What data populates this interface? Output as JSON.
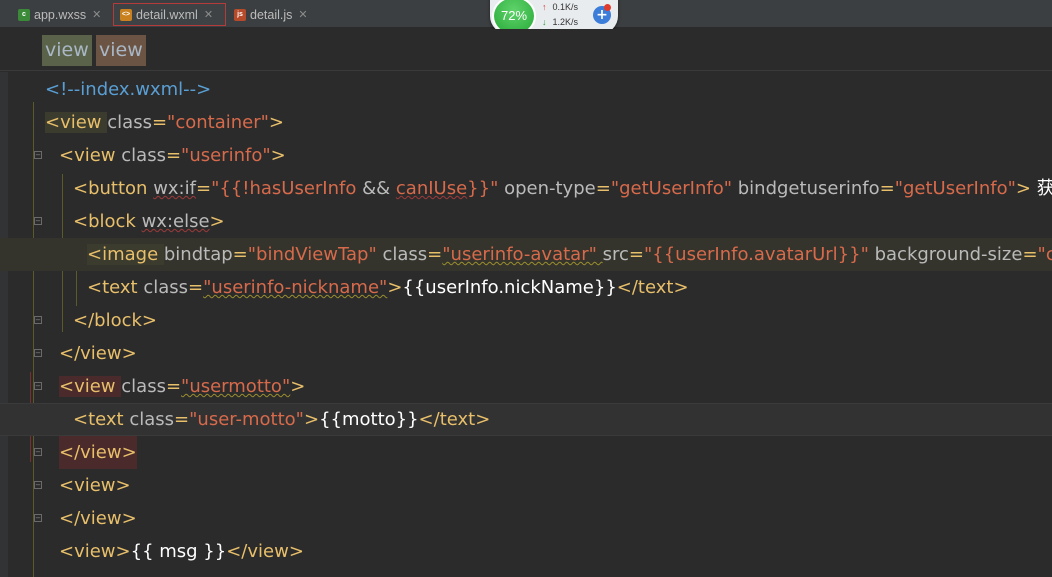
{
  "tabs": [
    {
      "label": "app.wxss",
      "icon": "css-file-icon",
      "active": false
    },
    {
      "label": "detail.wxml",
      "icon": "xml-file-icon",
      "active": true
    },
    {
      "label": "detail.js",
      "icon": "js-file-icon",
      "active": false
    }
  ],
  "net_widget": {
    "percent": "72%",
    "upload": "0.1K/s",
    "download": "1.2K/s"
  },
  "breadcrumb": [
    "view",
    "view"
  ],
  "code": {
    "l1": "<!--index.wxml-->",
    "l2_tag": "<view ",
    "l2_attr": "class",
    "l2_eq": "=",
    "l2_val": "\"container\"",
    "l2_end": ">",
    "l3_tag": "<view ",
    "l3_attr": "class",
    "l3_eq": "=",
    "l3_val": "\"userinfo\"",
    "l3_end": ">",
    "l4_tag": "<button ",
    "l4_a1": "wx:if",
    "l4_eq1": "=",
    "l4_v1a": "\"{{!hasUserInfo ",
    "l4_v1b": "&& ",
    "l4_v1c": "canIUse",
    "l4_v1d": "}}\" ",
    "l4_a2": "open-type",
    "l4_eq2": "=",
    "l4_v2": "\"getUserInfo\" ",
    "l4_a3": "bindgetuserinfo",
    "l4_eq3": "=",
    "l4_v3": "\"getUserInfo\"",
    "l4_end": "> ",
    "l4_text": "获取头像昵称",
    "l5_tag": "<block ",
    "l5_attr": "wx:else",
    "l5_end": ">",
    "l6_tag": "<image ",
    "l6_a1": "bindtap",
    "l6_eq1": "=",
    "l6_v1": "\"bindViewTap\" ",
    "l6_a2": "class",
    "l6_eq2": "=",
    "l6_v2": "\"userinfo-avatar\" ",
    "l6_a3": "src",
    "l6_eq3": "=",
    "l6_v3": "\"{{userInfo.avatarUrl}}\" ",
    "l6_a4": "background-size",
    "l6_eq4": "=",
    "l6_v4": "\"cover\"",
    "l7_tag": "<text ",
    "l7_attr": "class",
    "l7_eq": "=",
    "l7_val": "\"userinfo-nickname\"",
    "l7_gt": ">",
    "l7_text": "{{userInfo.nickName}}",
    "l7_end": "</text>",
    "l8": "</block>",
    "l9": "</view>",
    "l10_tag": "<view ",
    "l10_attr": "class",
    "l10_eq": "=",
    "l10_val": "\"usermotto\"",
    "l10_end": ">",
    "l11_tag": "<text ",
    "l11_attr": "class",
    "l11_eq": "=",
    "l11_val": "\"user-motto\"",
    "l11_gt": ">",
    "l11_text": "{{motto}}",
    "l11_end": "</text>",
    "l12": "</view>",
    "l13": "<view>",
    "l14": "</view>",
    "l15_open": "<view>",
    "l15_text": "{{ msg }}",
    "l15_close": "</view>"
  }
}
